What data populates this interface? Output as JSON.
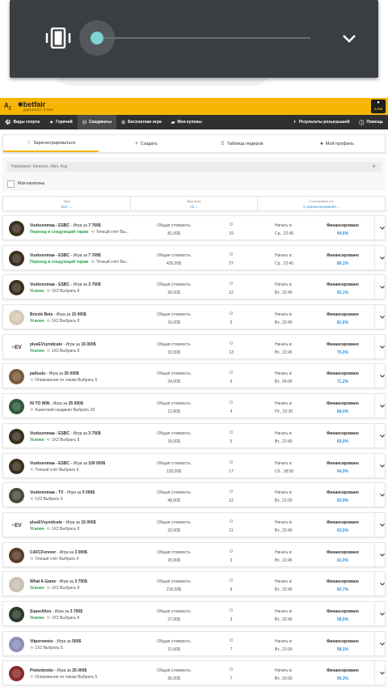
{
  "header": {
    "logo": "betfair",
    "logo_sub": "ДЖЕКПОТ ЕТКЕ"
  },
  "account": {
    "balance": "0,00$"
  },
  "nav": {
    "items": [
      {
        "label": "Виды спорта",
        "icon": "soccer-ball-icon"
      },
      {
        "label": "Горячий",
        "icon": "flame-icon"
      },
      {
        "label": "Синдикаты",
        "icon": "users-icon",
        "active": true
      },
      {
        "label": "Бесплатная игра",
        "icon": "gift-icon"
      },
      {
        "label": "Мои купоны",
        "icon": "ticket-icon"
      }
    ],
    "right_items": [
      {
        "label": "Результаты розыгрышей",
        "icon": "results-icon"
      },
      {
        "label": "Помощь",
        "icon": "info-icon"
      }
    ]
  },
  "tabs": [
    {
      "label": "Зарегистрироваться",
      "icon": "heart-icon",
      "active": true
    },
    {
      "label": "Создать",
      "icon": "plus-icon"
    },
    {
      "label": "Таблица лидеров",
      "icon": "trophy-icon"
    },
    {
      "label": "Мой профиль",
      "icon": "user-icon"
    }
  ],
  "search": {
    "placeholder": "Например: Капитан, Имя, Код"
  },
  "captains_label": "Мои капитаны",
  "filters": [
    {
      "label": "Тура",
      "value": "Все"
    },
    {
      "label": "Вид пула",
      "value": "All"
    },
    {
      "label": "Сортировать по:",
      "value": "% финансирования"
    }
  ],
  "labels": {
    "total_cost": "Общая стоимость",
    "start": "Начать в:",
    "funded": "Финансировано",
    "play_for": "Игра за"
  },
  "syndicates": [
    {
      "name": "Vuoksenmaa - ESBC",
      "prize": "7 769$",
      "status": "Переход в следующий тираж",
      "status_type": "next",
      "game": "Точный счёт Вы...",
      "cost": "81,00$",
      "players": "19",
      "start": "Ср., 22:45",
      "funded": "94,6%",
      "avatar": "#3b2f1e"
    },
    {
      "name": "Vuoksenmaa - ESBC",
      "prize": "7 769$",
      "status": "Переход в следующий тираж",
      "status_type": "next",
      "game": "Точный счёт Вы...",
      "cost": "425,00$",
      "players": "27",
      "start": "Ср., 22:45",
      "funded": "89,1%",
      "avatar": "#3b2f1e"
    },
    {
      "name": "Vuoksenmaa - ESBC",
      "prize": "3 750$",
      "status": "Усилен",
      "status_type": "boost",
      "game": "1X2 Выбрать 8",
      "cost": "36,00$",
      "players": "12",
      "start": "Вт., 22:45",
      "funded": "83,1%",
      "avatar": "#3b2f1e"
    },
    {
      "name": "Brizzle Bets",
      "prize": "15 000$",
      "status": "Усилен",
      "status_type": "boost",
      "game": "1X2 Выбрать 8",
      "cost": "16,00$",
      "players": "9",
      "start": "Вт., 22:45",
      "funded": "81,6%",
      "avatar": "#d8c9b6"
    },
    {
      "name": "plusEVsyndicate",
      "prize": "15 000$",
      "status": "Усилен",
      "status_type": "boost",
      "game": "1X2 Выбрать 8",
      "cost": "32,00$",
      "players": "13",
      "start": "Вт., 22:45",
      "funded": "75,0%",
      "avatar": "ev"
    },
    {
      "name": "palluulu",
      "prize": "25 000$",
      "status": "",
      "status_type": "",
      "game": "Опережение по очкам Выбрать 5",
      "cost": "24,00$",
      "players": "5",
      "start": "Вт., 04:00",
      "funded": "71,2%",
      "avatar": "#7a5a3c"
    },
    {
      "name": "IN TO WIN",
      "prize": "25 000$",
      "status": "",
      "status_type": "",
      "game": "Азиатский гандикап Выбрать 20",
      "cost": "12,80$",
      "players": "4",
      "start": "Пт., 22:30",
      "funded": "68,0%",
      "avatar": "#2f5a3a"
    },
    {
      "name": "Vuoksenmaa - ESBC",
      "prize": "3 750$",
      "status": "Усилен",
      "status_type": "boost",
      "game": "1X2 Выбрать 8",
      "cost": "18,00$",
      "players": "5",
      "start": "Вт., 22:45",
      "funded": "65,0%",
      "avatar": "#3b2f1e"
    },
    {
      "name": "Vuoksenmaa - ESBC",
      "prize": "100 000$",
      "status": "",
      "status_type": "",
      "game": "Точный счёт Выбрать 6",
      "cost": "120,00$",
      "players": "17",
      "start": "Сб., 18:00",
      "funded": "64,9%",
      "avatar": "#3b2f1e"
    },
    {
      "name": "Vuoksenmaa - TV",
      "prize": "5 000$",
      "status": "",
      "status_type": "",
      "game": "1X2 Выбрать 5",
      "cost": "48,00$",
      "players": "12",
      "start": "Вт., 21:00",
      "funded": "63,9%",
      "avatar": "#4a4a3a"
    },
    {
      "name": "plusEVsyndicate",
      "prize": "15 000$",
      "status": "Усилен",
      "status_type": "boost",
      "game": "1X2 Выбрать 8",
      "cost": "32,00$",
      "players": "11",
      "start": "Вт., 22:45",
      "funded": "63,5%",
      "avatar": "ev"
    },
    {
      "name": "CAFCForever",
      "prize": "3 000$",
      "status": "",
      "status_type": "",
      "game": "Точный счёт Выбрать 4",
      "cost": "20,00$",
      "players": "3",
      "start": "Вт., 22:45",
      "funded": "61,0%",
      "avatar": "#5a3a2a"
    },
    {
      "name": "What A Game",
      "prize": "3 750$",
      "status": "Усилен",
      "status_type": "boost",
      "game": "1X2 Выбрать 8",
      "cost": "216,00$",
      "players": "9",
      "start": "Вт., 22:45",
      "funded": "60,7%",
      "avatar": "#c9c2b0"
    },
    {
      "name": "SuperAltzu",
      "prize": "3 750$",
      "status": "Усилен",
      "status_type": "boost",
      "game": "1X2 Выбрать 8",
      "cost": "27,00$",
      "players": "3",
      "start": "Вт., 22:45",
      "funded": "58,6%",
      "avatar": "#2a3a2a"
    },
    {
      "name": "Vitporomiex",
      "prize": "500$",
      "status": "",
      "status_type": "",
      "game": "1X2 Выбрать 5",
      "cost": "21,60$",
      "players": "7",
      "start": "Вт., 21:00",
      "funded": "58,1%",
      "avatar": "#8a8fb8"
    },
    {
      "name": "Pistonbroke",
      "prize": "25 000$",
      "status": "",
      "status_type": "",
      "game": "Опережение по очкам Выбрать 5",
      "cost": "36,00$",
      "players": "7",
      "start": "Вт., 03:00",
      "funded": "56,3%",
      "avatar": "#8a2a2a"
    }
  ]
}
